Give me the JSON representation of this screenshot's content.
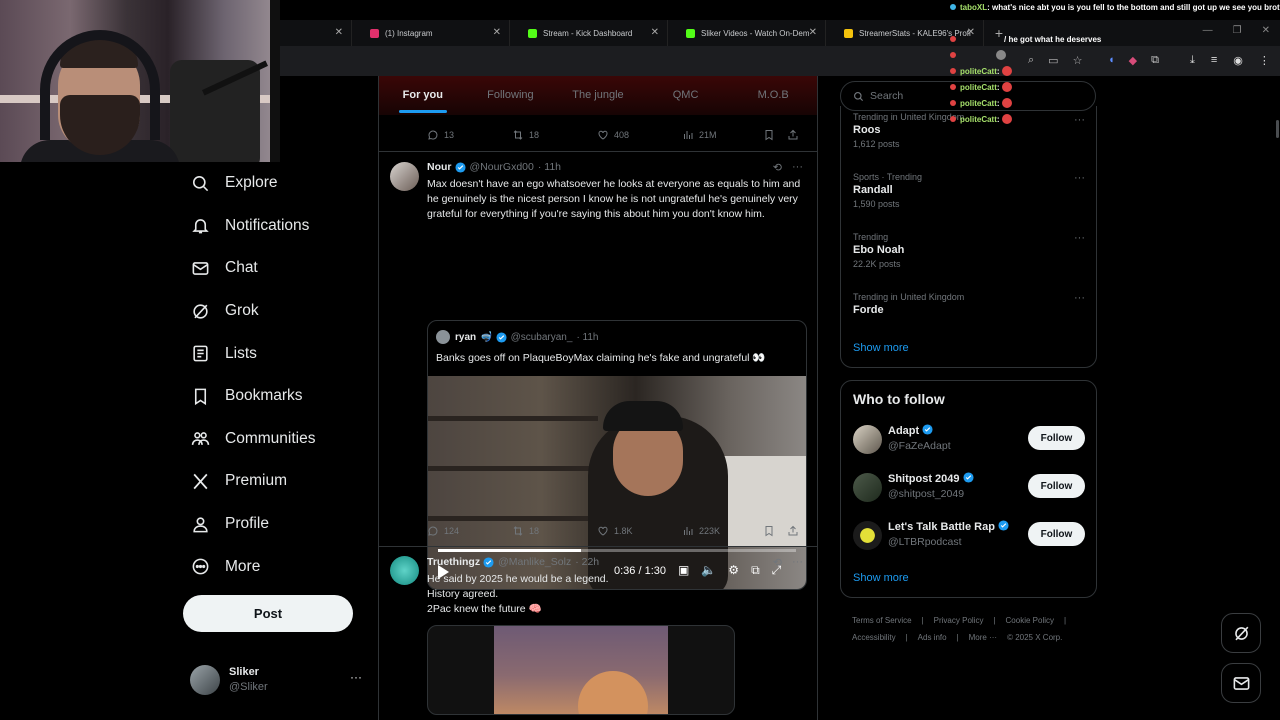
{
  "browser": {
    "tabs": [
      {
        "label": "",
        "color": "#1c1d20"
      },
      {
        "label": "(1) Instagram",
        "color": "#e1306c"
      },
      {
        "label": "Stream - Kick Dashboard",
        "color": "#53fc18"
      },
      {
        "label": "Sliker Videos - Watch On-Dem",
        "color": "#53fc18"
      },
      {
        "label": "StreamerStats - KALE96's Profi",
        "color": "#f4c20d"
      }
    ]
  },
  "chat": [
    {
      "user": "taboXL",
      "msg": ": what's nice abt you is you fell to the bottom and still got up we see you brotha"
    },
    {
      "user": "",
      "msg": "/ he got what he deserves"
    },
    {
      "user": "",
      "msg": ""
    },
    {
      "user": "politeCatt",
      "msg": ":"
    },
    {
      "user": "politeCatt",
      "msg": ":"
    },
    {
      "user": "politeCatt",
      "msg": ":"
    },
    {
      "user": "politeCatt",
      "msg": ":"
    }
  ],
  "nav": {
    "items": [
      {
        "label": "Explore",
        "icon": "search-icon"
      },
      {
        "label": "Notifications",
        "icon": "bell-icon"
      },
      {
        "label": "Chat",
        "icon": "mail-icon"
      },
      {
        "label": "Grok",
        "icon": "grok-icon"
      },
      {
        "label": "Lists",
        "icon": "list-icon"
      },
      {
        "label": "Bookmarks",
        "icon": "bookmark-icon"
      },
      {
        "label": "Communities",
        "icon": "communities-icon"
      },
      {
        "label": "Premium",
        "icon": "x-logo-icon"
      },
      {
        "label": "Profile",
        "icon": "profile-icon"
      },
      {
        "label": "More",
        "icon": "more-circle-icon"
      }
    ],
    "post_label": "Post",
    "account": {
      "name": "Sliker",
      "handle": "@Sliker"
    }
  },
  "feed": {
    "tabs": [
      "For you",
      "Following",
      "The jungle",
      "QMC",
      "M.O.B"
    ],
    "prev_actions": {
      "replies": "13",
      "reposts": "18",
      "likes": "408",
      "views": "21M"
    },
    "tweet1": {
      "name": "Nour",
      "handle": "@NourGxd00",
      "time": "· 11h",
      "text": "Max doesn't have an ego whatsoever he looks at everyone as equals to him and he genuinely is the nicest person I know he is not ungrateful he's genuinely very grateful for everything if you're saying this about him you don't know him.",
      "quote": {
        "name": "ryan",
        "handle": "@scubaryan_",
        "time": "· 11h",
        "text": "Banks goes off on PlaqueBoyMax claiming he's fake and ungrateful 👀",
        "video_time": "0:36 / 1:30",
        "progress": 0.4
      },
      "actions": {
        "replies": "124",
        "reposts": "18",
        "likes": "1.8K",
        "views": "223K"
      }
    },
    "tweet2": {
      "name": "Truethingz",
      "handle": "@Manlike_Solz",
      "time": "· 22h",
      "lines": [
        "He said by 2025 he would be a legend.",
        "History agreed.",
        "2Pac knew the future 🧠"
      ]
    }
  },
  "sidebar": {
    "search_placeholder": "Search",
    "trends": [
      {
        "category": "Trending in United Kingdom",
        "name": "Roos",
        "posts": "1,612 posts"
      },
      {
        "category": "Sports · Trending",
        "name": "Randall",
        "posts": "1,590 posts"
      },
      {
        "category": "Trending",
        "name": "Ebo Noah",
        "posts": "22.2K posts"
      },
      {
        "category": "Trending in United Kingdom",
        "name": "Forde",
        "posts": ""
      }
    ],
    "show_more": "Show more",
    "who_to_follow": {
      "title": "Who to follow",
      "accounts": [
        {
          "name": "Adapt",
          "handle": "@FaZeAdapt",
          "button": "Follow"
        },
        {
          "name": "Shitpost 2049",
          "handle": "@shitpost_2049",
          "button": "Follow"
        },
        {
          "name": "Let's Talk Battle Rap",
          "handle": "@LTBRpodcast",
          "button": "Follow"
        }
      ],
      "show_more": "Show more"
    },
    "footer": [
      "Terms of Service",
      "|",
      "Privacy Policy",
      "|",
      "Cookie Policy",
      "|",
      "Accessibility",
      "|",
      "Ads info",
      "|",
      "More ···",
      "© 2025 X Corp."
    ]
  },
  "colors": {
    "accent": "#1d9bf0",
    "verified": "#1d9bf0",
    "background": "#000000"
  }
}
